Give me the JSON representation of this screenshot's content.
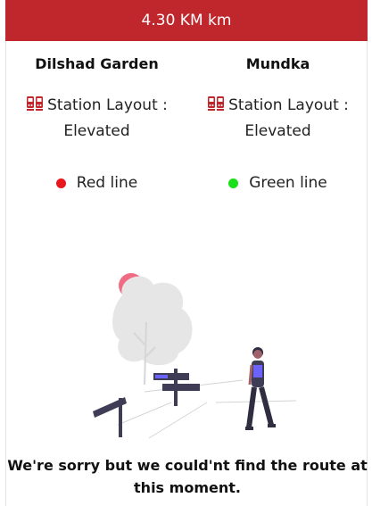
{
  "header": {
    "distance": "4.30 KM km"
  },
  "stations": [
    {
      "name": "Dilshad Garden",
      "layout_label": "Station Layout :",
      "layout_value": "Elevated",
      "line_name": "Red line",
      "line_color": "#e8161d"
    },
    {
      "name": "Mundka",
      "layout_label": "Station Layout :",
      "layout_value": "Elevated",
      "line_name": "Green line",
      "line_color": "#19e019"
    }
  ],
  "icons": {
    "station": "train-icon",
    "illustration": "lost-person-signpost-illustration"
  },
  "colors": {
    "header": "#c0272d",
    "accent": "#e8161d"
  },
  "message": {
    "text": "We're sorry but we could'nt find the route at this moment."
  }
}
